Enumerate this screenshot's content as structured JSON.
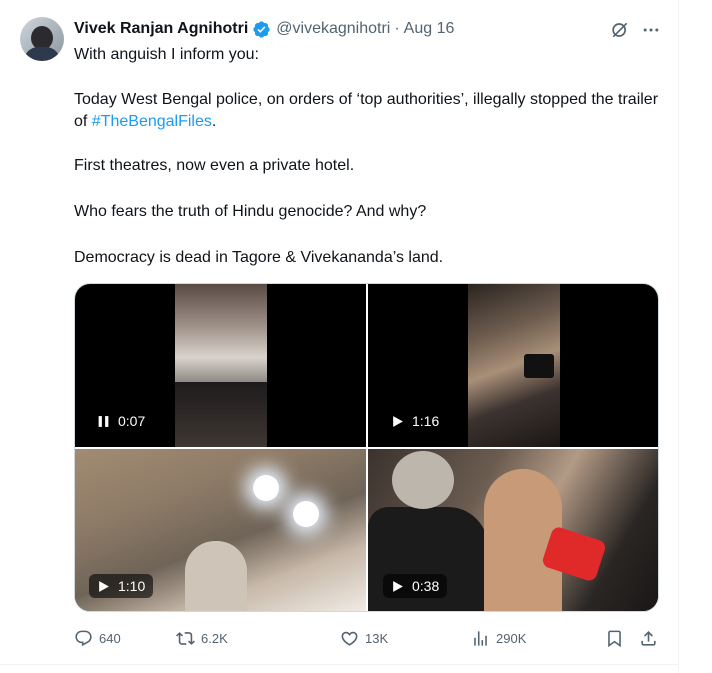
{
  "tweet": {
    "author_name": "Vivek Ranjan Agnihotri",
    "handle": "@vivekagnihotri",
    "separator": "·",
    "date": "Aug 16",
    "text": {
      "p1": "With anguish I inform you:",
      "p2_before": "Today West Bengal police, on orders of ‘top authorities’, illegally stopped the trailer of ",
      "p2_hashtag": "#TheBengalFiles",
      "p2_after": ".",
      "p3": "First theatres, now even a private hotel.",
      "p4": "Who fears the truth of Hindu genocide? And why?",
      "p5": "Democracy is dead in Tagore & Vivekananda’s land."
    },
    "media": [
      {
        "duration": "0:07",
        "state_icon": "pause-icon"
      },
      {
        "duration": "1:16",
        "state_icon": "play-icon"
      },
      {
        "duration": "1:10",
        "state_icon": "play-icon"
      },
      {
        "duration": "0:38",
        "state_icon": "play-icon"
      }
    ],
    "actions": {
      "replies": "640",
      "reposts": "6.2K",
      "likes": "13K",
      "views": "290K"
    }
  },
  "colors": {
    "accent": "#1d9bf0",
    "secondary_text": "#536471",
    "primary_text": "#0f1419"
  }
}
